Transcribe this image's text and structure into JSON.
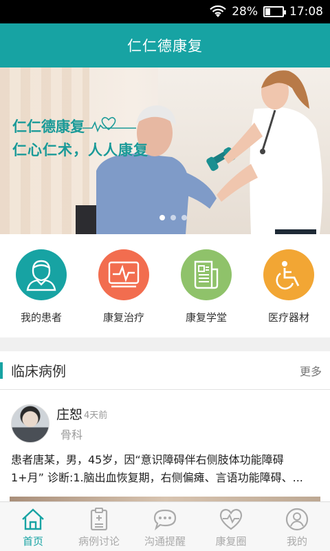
{
  "status_bar": {
    "battery": "28%",
    "time": "17:08",
    "battery_level": 0.28
  },
  "app_bar": {
    "title": "仁仁德康复"
  },
  "banner": {
    "line1": "仁仁德康复",
    "line2": "仁心仁术，人人康复",
    "slide_count": 3,
    "active_slide": 0
  },
  "quick_menu": [
    {
      "label": "我的患者",
      "icon": "patient-icon",
      "color": "#17a3a3"
    },
    {
      "label": "康复治疗",
      "icon": "monitor-heartbeat-icon",
      "color": "#f26d4f"
    },
    {
      "label": "康复学堂",
      "icon": "document-icon",
      "color": "#8fc26a"
    },
    {
      "label": "医疗器材",
      "icon": "wheelchair-icon",
      "color": "#f2a634"
    }
  ],
  "section": {
    "title": "临床病例",
    "more": "更多"
  },
  "post": {
    "author": "庄恕",
    "time": "4天前",
    "department": "骨科",
    "line1": "患者唐某，男，45岁，因“意识障碍伴右侧肢体功能障碍",
    "line2": "1+月” 诊断:1.脑出血恢复期，右侧偏瘫、言语功能障碍、..."
  },
  "bottom_nav": [
    {
      "label": "首页",
      "icon": "home-icon",
      "active": true
    },
    {
      "label": "病例讨论",
      "icon": "clipboard-icon",
      "active": false
    },
    {
      "label": "沟通提醒",
      "icon": "chat-icon",
      "active": false
    },
    {
      "label": "康复圈",
      "icon": "heartbeat-icon",
      "active": false
    },
    {
      "label": "我的",
      "icon": "profile-icon",
      "active": false
    }
  ],
  "colors": {
    "primary": "#17a3a3",
    "status_bar": "#000000"
  }
}
